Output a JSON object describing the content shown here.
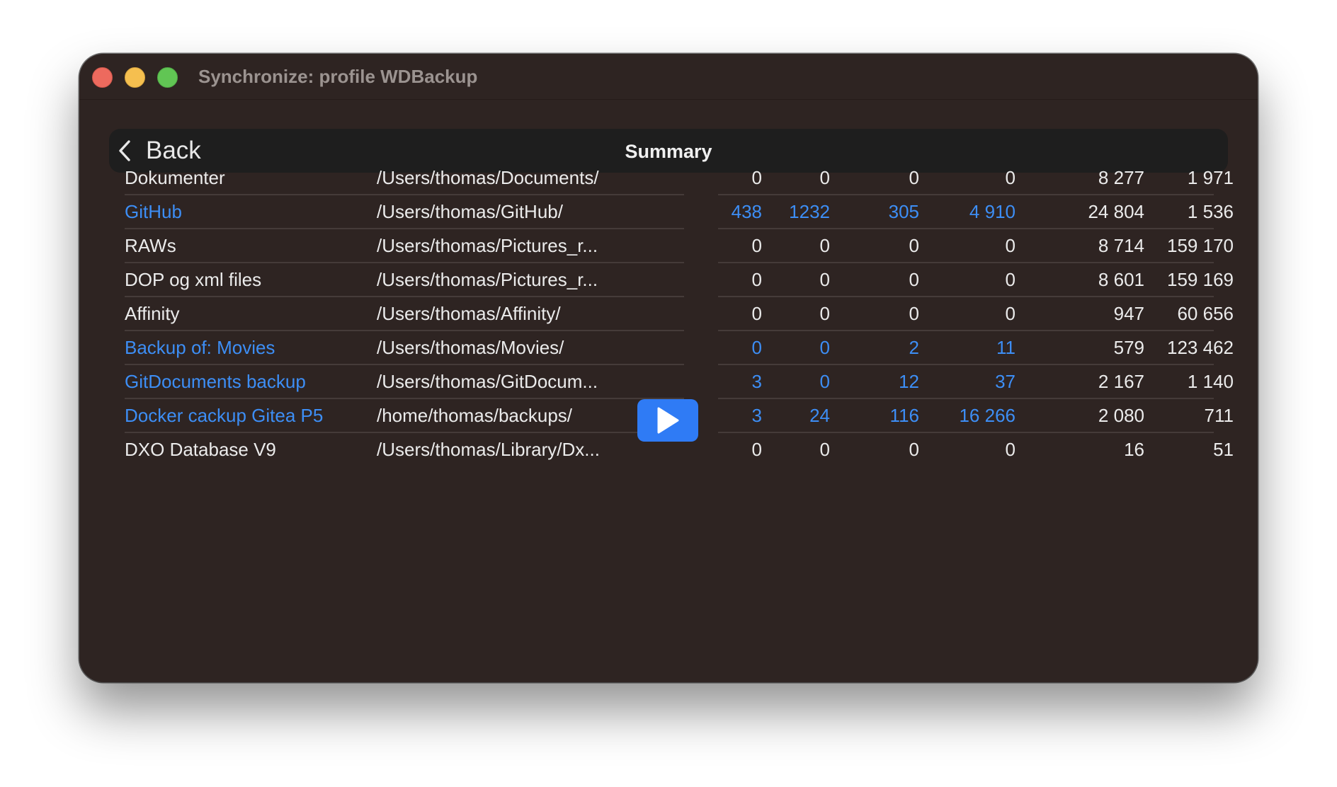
{
  "window": {
    "title": "Synchronize: profile WDBackup"
  },
  "navbar": {
    "back_label": "Back",
    "title": "Summary"
  },
  "colors": {
    "accent": "#3d8ef5",
    "window_bg": "#2e2422",
    "navbar_bg": "#1e1e1e",
    "play_button": "#2f7bf5"
  },
  "rows": [
    {
      "name": "Dokumenter",
      "path": "/Users/thomas/Documents/",
      "v1": "0",
      "v2": "0",
      "v3": "0",
      "v4": "0",
      "v5": "8 277",
      "v6": "1 971",
      "highlight": false
    },
    {
      "name": "GitHub",
      "path": "/Users/thomas/GitHub/",
      "v1": "438",
      "v2": "1232",
      "v3": "305",
      "v4": "4 910",
      "v5": "24 804",
      "v6": "1 536",
      "highlight": true
    },
    {
      "name": "RAWs",
      "path": "/Users/thomas/Pictures_r...",
      "v1": "0",
      "v2": "0",
      "v3": "0",
      "v4": "0",
      "v5": "8 714",
      "v6": "159 170",
      "highlight": false
    },
    {
      "name": "DOP og xml files",
      "path": "/Users/thomas/Pictures_r...",
      "v1": "0",
      "v2": "0",
      "v3": "0",
      "v4": "0",
      "v5": "8 601",
      "v6": "159 169",
      "highlight": false
    },
    {
      "name": "Affinity",
      "path": "/Users/thomas/Affinity/",
      "v1": "0",
      "v2": "0",
      "v3": "0",
      "v4": "0",
      "v5": "947",
      "v6": "60 656",
      "highlight": false
    },
    {
      "name": "Backup of: Movies",
      "path": "/Users/thomas/Movies/",
      "v1": "0",
      "v2": "0",
      "v3": "2",
      "v4": "11",
      "v5": "579",
      "v6": "123 462",
      "highlight": true
    },
    {
      "name": "GitDocuments backup",
      "path": "/Users/thomas/GitDocum...",
      "v1": "3",
      "v2": "0",
      "v3": "12",
      "v4": "37",
      "v5": "2 167",
      "v6": "1 140",
      "highlight": true
    },
    {
      "name": "Docker cackup Gitea P5",
      "path": "/home/thomas/backups/",
      "v1": "3",
      "v2": "24",
      "v3": "116",
      "v4": "16 266",
      "v5": "2 080",
      "v6": "711",
      "highlight": true
    },
    {
      "name": "DXO Database V9",
      "path": "/Users/thomas/Library/Dx...",
      "v1": "0",
      "v2": "0",
      "v3": "0",
      "v4": "0",
      "v5": "16",
      "v6": "51",
      "highlight": false
    }
  ],
  "icons": {
    "back": "chevron-left-icon",
    "play": "play-icon"
  }
}
